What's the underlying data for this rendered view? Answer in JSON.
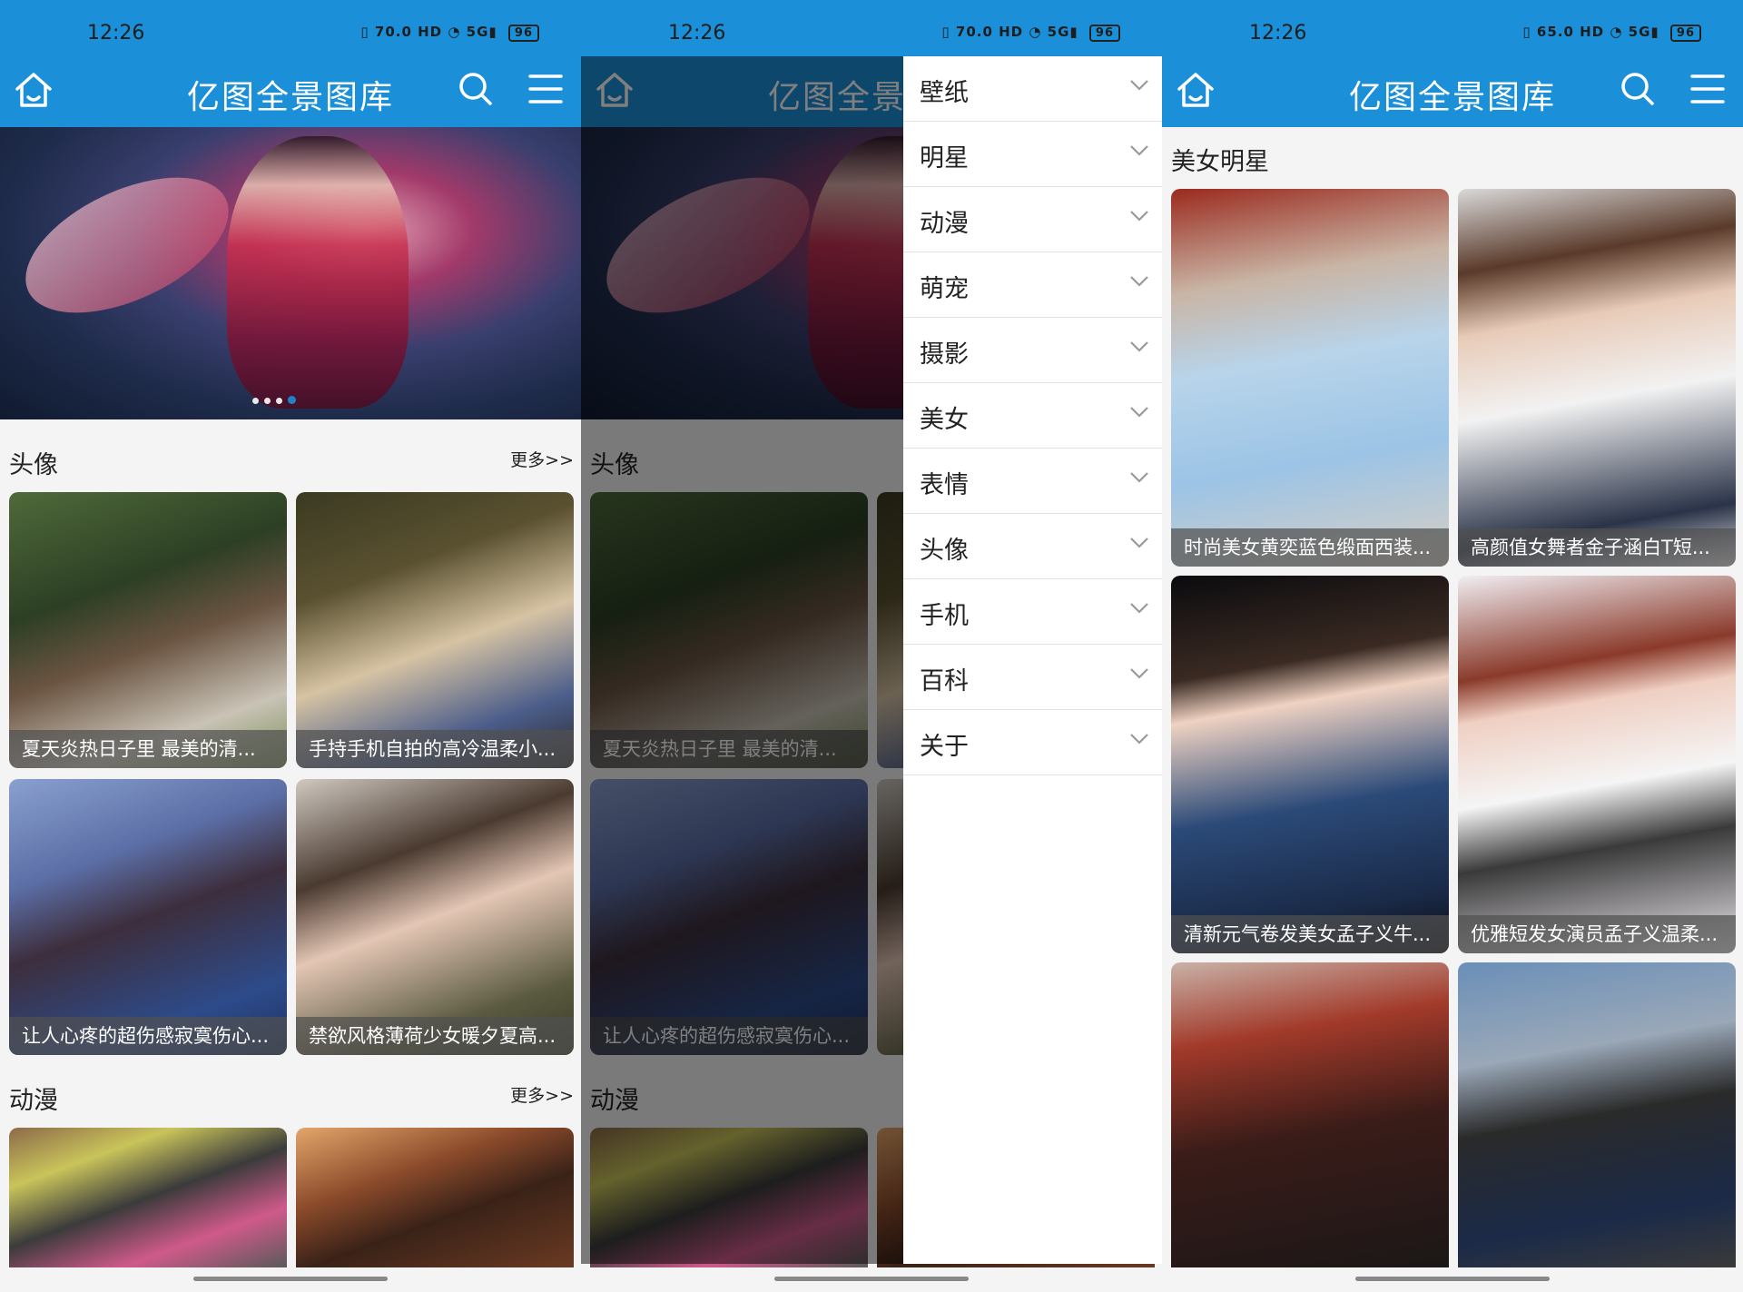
{
  "status_bar": {
    "time": "12:26",
    "battery": "96",
    "net_speed_1": "70.0",
    "net_speed_2": "70.0",
    "net_speed_3": "65.0"
  },
  "app": {
    "title": "亿图全景图库"
  },
  "home": {
    "sections": [
      {
        "title": "头像",
        "more": "更多>>",
        "cards": [
          "夏天炎热日子里 最美的清...",
          "手持手机自拍的高冷温柔小...",
          "让人心疼的超伤感寂寞伤心...",
          "禁欲风格薄荷少女暖夕夏高..."
        ]
      },
      {
        "title": "动漫",
        "more": "更多>>"
      }
    ]
  },
  "drawer": {
    "items": [
      "壁纸",
      "明星",
      "动漫",
      "萌宠",
      "摄影",
      "美女",
      "表情",
      "头像",
      "手机",
      "百科",
      "关于"
    ]
  },
  "gallery": {
    "title": "美女明星",
    "cards": [
      "时尚美女黄奕蓝色缎面西装...",
      "高颜值女舞者金子涵白T短...",
      "清新元气卷发美女孟子义牛...",
      "优雅短发女演员孟子义温柔..."
    ]
  },
  "colors": {
    "primary": "#1b8fd8"
  },
  "icons": [
    "home-icon",
    "search-icon",
    "menu-icon",
    "chevron-down-icon"
  ]
}
